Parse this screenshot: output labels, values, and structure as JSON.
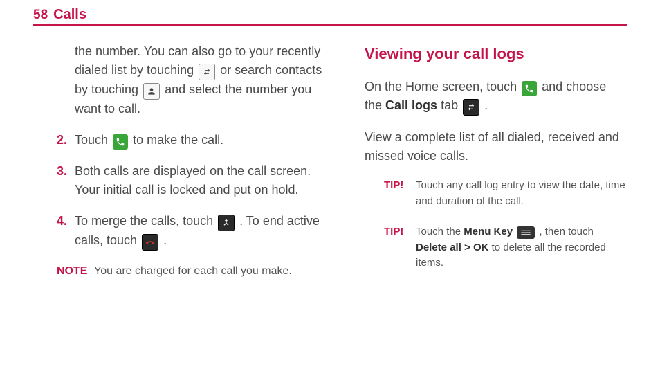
{
  "header": {
    "page_number": "58",
    "title": "Calls"
  },
  "left": {
    "intro_part1": "the number. You can also go to your recently dialed list by touching ",
    "intro_part2": " or search contacts by touching ",
    "intro_part3": " and select the number you want to call.",
    "steps": [
      {
        "num": "2.",
        "before": "Touch ",
        "after": " to make the call."
      },
      {
        "num": "3.",
        "text": "Both calls are displayed on the call screen. Your initial call is locked and put on hold."
      },
      {
        "num": "4.",
        "before": "To merge the calls, touch ",
        "mid": ". To end active calls, touch ",
        "after": "."
      }
    ],
    "note": {
      "label": "NOTE",
      "text": "You are charged for each call you make."
    }
  },
  "right": {
    "title": "Viewing your call logs",
    "p1_before": "On the Home screen, touch ",
    "p1_mid": " and choose the ",
    "p1_bold": "Call logs",
    "p1_after_bold": " tab ",
    "p1_end": ".",
    "p2": "View a complete list of all dialed, received and missed voice calls.",
    "tips": [
      {
        "label": "TIP!",
        "text": "Touch any call log entry to view the date, time and duration of the call."
      },
      {
        "label": "TIP!",
        "before": "Touch the ",
        "bold1": "Menu Key ",
        "mid": ", then touch ",
        "bold2": "Delete all > OK",
        "after": " to delete all the recorded items."
      }
    ]
  }
}
